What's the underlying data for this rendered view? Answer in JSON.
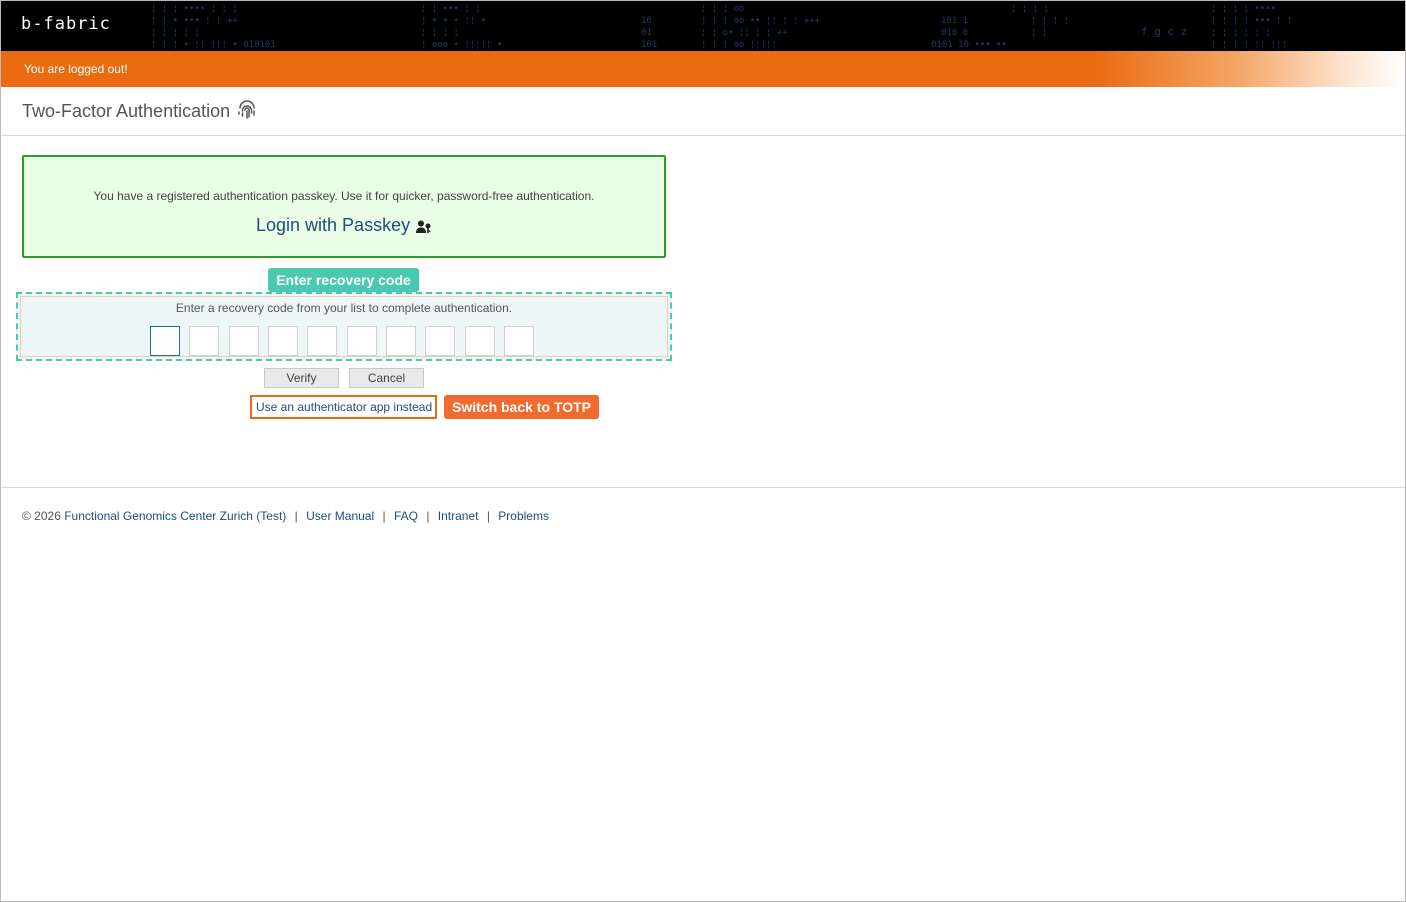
{
  "header": {
    "logo_text": "b-fabric"
  },
  "status": {
    "message": "You are logged out!"
  },
  "title": {
    "text": "Two-Factor Authentication",
    "icon": "fingerprint-icon"
  },
  "passkey": {
    "message": "You have a registered authentication passkey. Use it for quicker, password-free authentication.",
    "link_label": "Login with Passkey",
    "icon": "passkey-user-key-icon"
  },
  "recovery": {
    "label": "Enter recovery code",
    "instruction": "Enter a recovery code from your list to complete authentication.",
    "code_fields": [
      "",
      "",
      "",
      "",
      "",
      "",
      "",
      "",
      "",
      ""
    ]
  },
  "actions": {
    "verify_label": "Verify",
    "cancel_label": "Cancel",
    "alt_link_label": "Use an authenticator app instead",
    "totp_badge": "Switch back to TOTP"
  },
  "footer": {
    "copyright": "© 2026",
    "org_link": "Functional Genomics Center Zurich (Test)",
    "links": [
      "User Manual",
      "FAQ",
      "Intranet",
      "Problems"
    ],
    "separator": "|"
  },
  "colors": {
    "accent_orange": "#ea6b12",
    "passkey_green": "#2e9e2a",
    "teal": "#48c9b0",
    "badge_orange": "#f26b2e",
    "link_blue": "#1e4e7c"
  }
}
